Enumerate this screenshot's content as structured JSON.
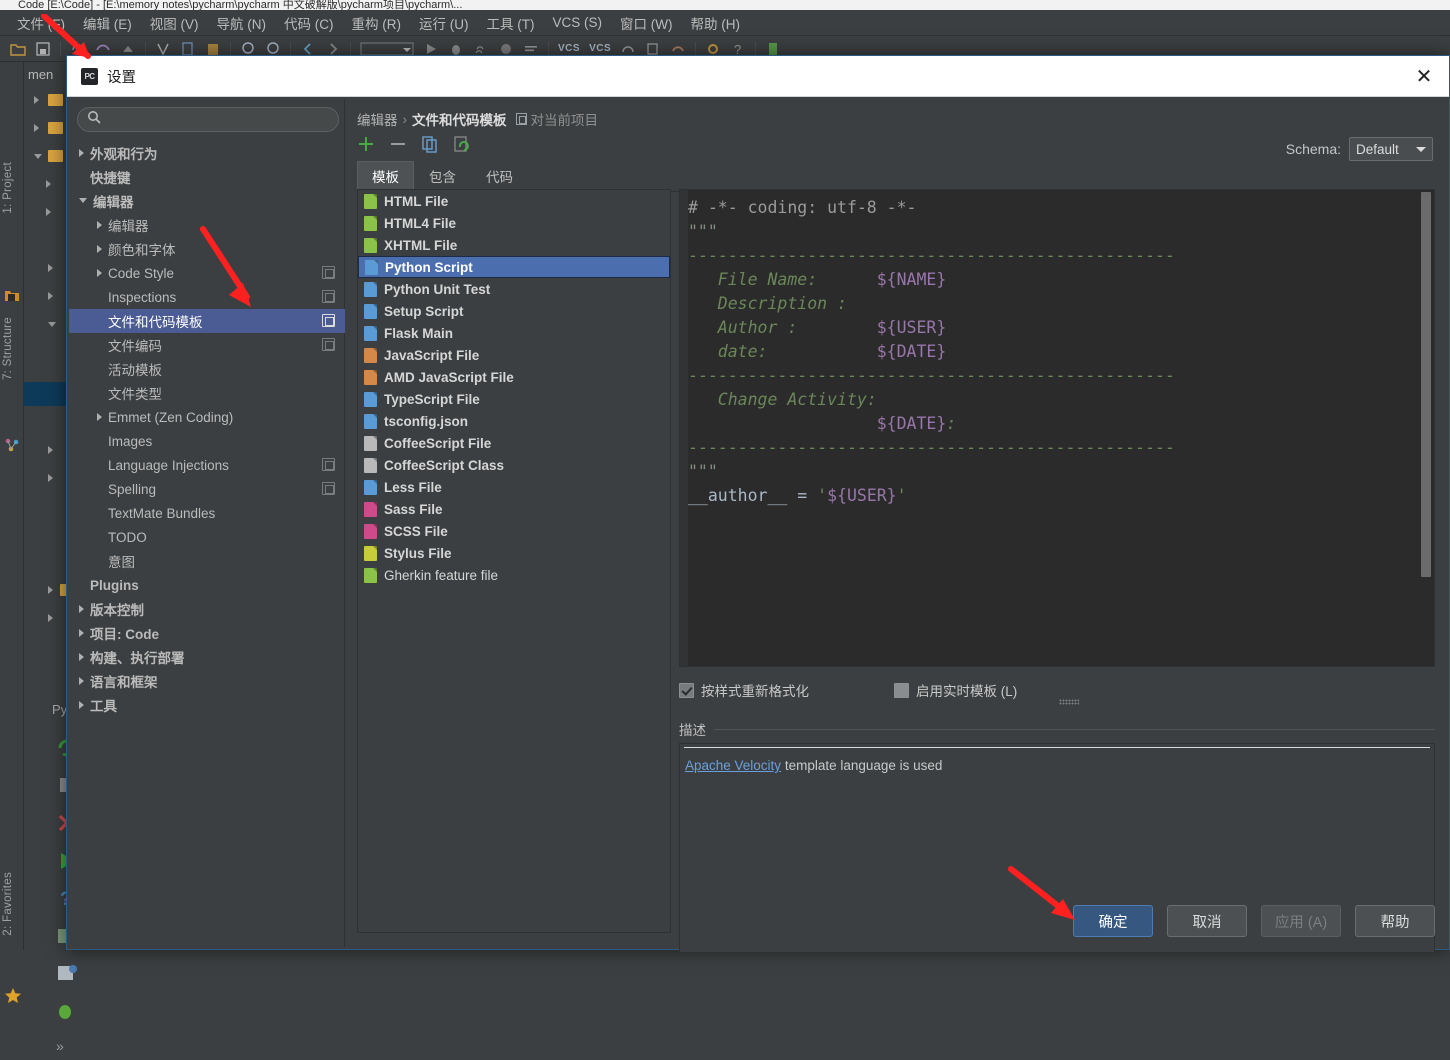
{
  "ide": {
    "title_bar": "Code  [E:\\Code] - [E:\\memory notes\\pycharm\\pycharm 中文破解版\\pycharm项目\\pycharm\\...",
    "menus": [
      "文件 (F)",
      "编辑 (E)",
      "视图 (V)",
      "导航 (N)",
      "代码 (C)",
      "重构 (R)",
      "运行 (U)",
      "工具 (T)",
      "VCS (S)",
      "窗口 (W)",
      "帮助 (H)"
    ],
    "toolbar_icons": [
      "open-folder-icon",
      "save-all-icon",
      "sync-icon",
      "undo-arrow-icon",
      "redo-arrow-icon",
      "compare-icon",
      "copy-file-icon",
      "paste-file-icon",
      "search-everywhere-icon",
      "find-icon",
      "back-icon",
      "forward-icon",
      "run-config-dropdown-icon",
      "run-icon",
      "debug-icon",
      "coverage-icon",
      "profile-icon",
      "stack-icon",
      "vcs-update-icon",
      "vcs-commit-icon",
      "history-icon",
      "push-icon",
      "revert-icon",
      "settings-icon",
      "help-icon",
      "structure-icon"
    ],
    "toolbar_vcs_labels": [
      "VCS",
      "VCS"
    ],
    "left_tabs": [
      "1: Project",
      "7: Structure",
      "2: Favorites"
    ],
    "project_header": "men",
    "run_panel_label": "Pytho",
    "run_icons": [
      "rerun-icon",
      "stop-icon",
      "close-x-icon",
      "run-green-icon",
      "question-icon",
      "soft-wrap-icon",
      "print-icon",
      "debug-bug-icon",
      "more-chevrons-icon"
    ]
  },
  "dialog": {
    "icon_label": "PC",
    "title": "设置",
    "close_label": "✕",
    "search": {
      "value": "",
      "placeholder": ""
    },
    "settings_tree": [
      {
        "label": "外观和行为",
        "indent": 0,
        "arrow": "closed",
        "bold": true,
        "badge": false,
        "selected": false
      },
      {
        "label": "快捷键",
        "indent": 0,
        "arrow": "none",
        "bold": true,
        "badge": false,
        "selected": false
      },
      {
        "label": "编辑器",
        "indent": 0,
        "arrow": "open",
        "bold": true,
        "badge": false,
        "selected": false
      },
      {
        "label": "编辑器",
        "indent": 1,
        "arrow": "closed",
        "bold": false,
        "badge": false,
        "selected": false
      },
      {
        "label": "颜色和字体",
        "indent": 1,
        "arrow": "closed",
        "bold": false,
        "badge": false,
        "selected": false
      },
      {
        "label": "Code Style",
        "indent": 1,
        "arrow": "closed",
        "bold": false,
        "badge": true,
        "selected": false
      },
      {
        "label": "Inspections",
        "indent": 1,
        "arrow": "none",
        "bold": false,
        "badge": true,
        "selected": false
      },
      {
        "label": "文件和代码模板",
        "indent": 1,
        "arrow": "none",
        "bold": false,
        "badge": true,
        "selected": true
      },
      {
        "label": "文件编码",
        "indent": 1,
        "arrow": "none",
        "bold": false,
        "badge": true,
        "selected": false
      },
      {
        "label": "活动模板",
        "indent": 1,
        "arrow": "none",
        "bold": false,
        "badge": false,
        "selected": false
      },
      {
        "label": "文件类型",
        "indent": 1,
        "arrow": "none",
        "bold": false,
        "badge": false,
        "selected": false
      },
      {
        "label": "Emmet (Zen Coding)",
        "indent": 1,
        "arrow": "closed",
        "bold": false,
        "badge": false,
        "selected": false
      },
      {
        "label": "Images",
        "indent": 1,
        "arrow": "none",
        "bold": false,
        "badge": false,
        "selected": false
      },
      {
        "label": "Language Injections",
        "indent": 1,
        "arrow": "none",
        "bold": false,
        "badge": true,
        "selected": false
      },
      {
        "label": "Spelling",
        "indent": 1,
        "arrow": "none",
        "bold": false,
        "badge": true,
        "selected": false
      },
      {
        "label": "TextMate Bundles",
        "indent": 1,
        "arrow": "none",
        "bold": false,
        "badge": false,
        "selected": false
      },
      {
        "label": "TODO",
        "indent": 1,
        "arrow": "none",
        "bold": false,
        "badge": false,
        "selected": false
      },
      {
        "label": "意图",
        "indent": 1,
        "arrow": "none",
        "bold": false,
        "badge": false,
        "selected": false
      },
      {
        "label": "Plugins",
        "indent": 0,
        "arrow": "none",
        "bold": true,
        "badge": false,
        "selected": false
      },
      {
        "label": "版本控制",
        "indent": 0,
        "arrow": "closed",
        "bold": true,
        "badge": false,
        "selected": false
      },
      {
        "label": "项目: Code",
        "indent": 0,
        "arrow": "closed",
        "bold": true,
        "badge": false,
        "selected": false
      },
      {
        "label": "构建、执行部署",
        "indent": 0,
        "arrow": "closed",
        "bold": true,
        "badge": false,
        "selected": false
      },
      {
        "label": "语言和框架",
        "indent": 0,
        "arrow": "closed",
        "bold": true,
        "badge": false,
        "selected": false
      },
      {
        "label": "工具",
        "indent": 0,
        "arrow": "closed",
        "bold": true,
        "badge": false,
        "selected": false
      }
    ],
    "breadcrumb": {
      "root": "编辑器",
      "separator": "›",
      "current": "文件和代码模板",
      "scope": "对当前项目"
    },
    "schema": {
      "label": "Schema:",
      "value": "Default"
    },
    "toolbar_actions": [
      "add-icon",
      "remove-icon",
      "copy-icon",
      "reset-icon"
    ],
    "tabs": [
      {
        "label": "模板",
        "active": true
      },
      {
        "label": "包含",
        "active": false
      },
      {
        "label": "代码",
        "active": false
      }
    ],
    "templates": [
      {
        "label": "HTML File",
        "icon": "html-file-icon",
        "color": "#8bc34a",
        "bold": true,
        "selected": false
      },
      {
        "label": "HTML4 File",
        "icon": "html4-file-icon",
        "color": "#8bc34a",
        "bold": true,
        "selected": false
      },
      {
        "label": "XHTML File",
        "icon": "xhtml-file-icon",
        "color": "#8bc34a",
        "bold": true,
        "selected": false
      },
      {
        "label": "Python Script",
        "icon": "python-file-icon",
        "color": "#5b9bd5",
        "bold": true,
        "selected": true
      },
      {
        "label": "Python Unit Test",
        "icon": "python-file-icon",
        "color": "#5b9bd5",
        "bold": true,
        "selected": false
      },
      {
        "label": "Setup Script",
        "icon": "python-file-icon",
        "color": "#5b9bd5",
        "bold": true,
        "selected": false
      },
      {
        "label": "Flask Main",
        "icon": "python-file-icon",
        "color": "#5b9bd5",
        "bold": true,
        "selected": false
      },
      {
        "label": "JavaScript File",
        "icon": "javascript-file-icon",
        "color": "#d4884a",
        "bold": true,
        "selected": false
      },
      {
        "label": "AMD JavaScript File",
        "icon": "javascript-file-icon",
        "color": "#d4884a",
        "bold": true,
        "selected": false
      },
      {
        "label": "TypeScript File",
        "icon": "typescript-file-icon",
        "color": "#5b9bd5",
        "bold": true,
        "selected": false
      },
      {
        "label": "tsconfig.json",
        "icon": "json-file-icon",
        "color": "#5b9bd5",
        "bold": true,
        "selected": false
      },
      {
        "label": "CoffeeScript File",
        "icon": "coffeescript-file-icon",
        "color": "#b9b9b9",
        "bold": true,
        "selected": false
      },
      {
        "label": "CoffeeScript Class",
        "icon": "coffeescript-file-icon",
        "color": "#b9b9b9",
        "bold": true,
        "selected": false
      },
      {
        "label": "Less File",
        "icon": "less-file-icon",
        "color": "#5b9bd5",
        "bold": true,
        "selected": false
      },
      {
        "label": "Sass File",
        "icon": "sass-file-icon",
        "color": "#cf4a8b",
        "bold": true,
        "selected": false
      },
      {
        "label": "SCSS File",
        "icon": "scss-file-icon",
        "color": "#cf4a8b",
        "bold": true,
        "selected": false
      },
      {
        "label": "Stylus File",
        "icon": "stylus-file-icon",
        "color": "#c6cc3a",
        "bold": true,
        "selected": false
      },
      {
        "label": "Gherkin feature file",
        "icon": "gherkin-file-icon",
        "color": "#8bc34a",
        "bold": false,
        "selected": false
      }
    ],
    "editor": {
      "lines": [
        [
          {
            "t": "# -*- coding: utf-8 -*-",
            "c": "c-comment"
          }
        ],
        [
          {
            "t": "\"\"\"",
            "c": "c-str"
          }
        ],
        [
          {
            "t": "",
            "c": "c-plain"
          }
        ],
        [
          {
            "t": "-------------------------------------------------",
            "c": "c-dash"
          }
        ],
        [
          {
            "t": "   File Name:      ",
            "c": "c-doc"
          },
          {
            "t": "${NAME}",
            "c": "c-var"
          }
        ],
        [
          {
            "t": "   Description :",
            "c": "c-doc"
          }
        ],
        [
          {
            "t": "   Author :        ",
            "c": "c-doc"
          },
          {
            "t": "${USER}",
            "c": "c-var"
          }
        ],
        [
          {
            "t": "   date:           ",
            "c": "c-doc"
          },
          {
            "t": "${DATE}",
            "c": "c-var"
          }
        ],
        [
          {
            "t": "-------------------------------------------------",
            "c": "c-dash"
          }
        ],
        [
          {
            "t": "   Change Activity:",
            "c": "c-doc"
          }
        ],
        [
          {
            "t": "                   ",
            "c": "c-doc"
          },
          {
            "t": "${DATE}",
            "c": "c-var"
          },
          {
            "t": ":",
            "c": "c-doc"
          }
        ],
        [
          {
            "t": "-------------------------------------------------",
            "c": "c-dash"
          }
        ],
        [
          {
            "t": "\"\"\"",
            "c": "c-str"
          }
        ],
        [
          {
            "t": "__author__ = ",
            "c": "c-plain"
          },
          {
            "t": "'",
            "c": "c-sq"
          },
          {
            "t": "${USER}",
            "c": "c-var"
          },
          {
            "t": "'",
            "c": "c-sq"
          }
        ]
      ]
    },
    "options": [
      {
        "label": "按样式重新格式化",
        "checked": true
      },
      {
        "label": "启用实时模板 (L)",
        "checked": false
      }
    ],
    "description": {
      "label": "描述",
      "link_text": "Apache Velocity",
      "rest_text": " template language is used"
    },
    "buttons": [
      {
        "label": "确定",
        "style": "primary"
      },
      {
        "label": "取消",
        "style": "normal"
      },
      {
        "label": "应用 (A)",
        "style": "disabled"
      },
      {
        "label": "帮助",
        "style": "normal"
      }
    ]
  },
  "colors": {
    "accent_selection_blue": "#4b6eaf",
    "tree_selection": "#4b5b93",
    "panel_bg": "#3c3f41",
    "editor_bg": "#2b2b2b",
    "primary_button": "#365880",
    "annotation_red": "#ff2020"
  }
}
